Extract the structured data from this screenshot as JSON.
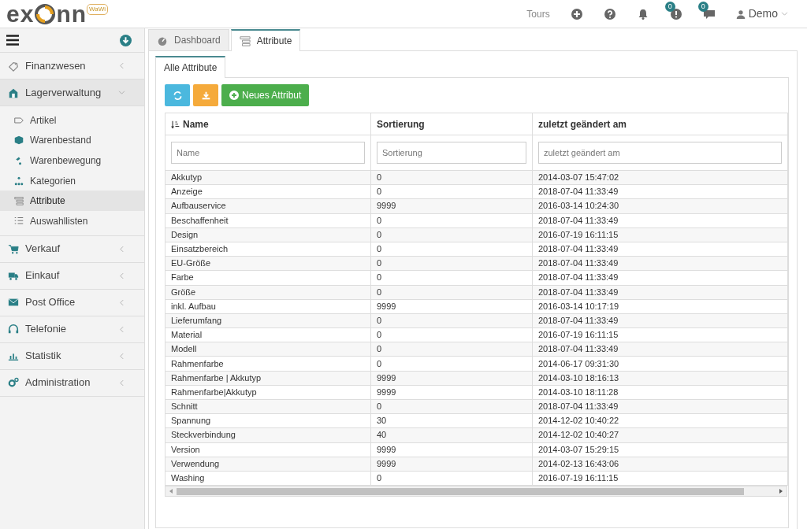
{
  "logo": {
    "left": "ex",
    "right": "nn",
    "badge": "WaWi"
  },
  "header": {
    "tours": "Tours",
    "alert_count": "0",
    "message_count": "0",
    "user": "Demo"
  },
  "sidebar": {
    "items": [
      {
        "label": "Finanzwesen",
        "expanded": false
      },
      {
        "label": "Lagerverwaltung",
        "expanded": true,
        "children": [
          {
            "label": "Artikel",
            "selected": false
          },
          {
            "label": "Warenbestand",
            "selected": false
          },
          {
            "label": "Warenbewegung",
            "selected": false
          },
          {
            "label": "Kategorien",
            "selected": false
          },
          {
            "label": "Attribute",
            "selected": true
          },
          {
            "label": "Auswahllisten",
            "selected": false
          }
        ]
      },
      {
        "label": "Verkauf",
        "expanded": false
      },
      {
        "label": "Einkauf",
        "expanded": false
      },
      {
        "label": "Post Office",
        "expanded": false
      },
      {
        "label": "Telefonie",
        "expanded": false
      },
      {
        "label": "Statistik",
        "expanded": false
      },
      {
        "label": "Administration",
        "expanded": false
      }
    ]
  },
  "tabs": [
    {
      "label": "Dashboard",
      "selected": false
    },
    {
      "label": "Attribute",
      "selected": true
    }
  ],
  "subtabs": [
    {
      "label": "Alle Attribute",
      "selected": true
    }
  ],
  "toolbar": {
    "new_button": "Neues Attribut"
  },
  "table": {
    "columns": [
      {
        "label": "Name",
        "placeholder": "Name",
        "sorted": true
      },
      {
        "label": "Sortierung",
        "placeholder": "Sortierung",
        "sorted": false
      },
      {
        "label": "zuletzt geändert am",
        "placeholder": "zuletzt geändert am",
        "sorted": false
      }
    ],
    "rows": [
      [
        "Akkutyp",
        "0",
        "2014-03-07 15:47:02"
      ],
      [
        "Anzeige",
        "0",
        "2018-07-04 11:33:49"
      ],
      [
        "Aufbauservice",
        "9999",
        "2016-03-14 10:24:30"
      ],
      [
        "Beschaffenheit",
        "0",
        "2018-07-04 11:33:49"
      ],
      [
        "Design",
        "0",
        "2016-07-19 16:11:15"
      ],
      [
        "Einsatzbereich",
        "0",
        "2018-07-04 11:33:49"
      ],
      [
        "EU-Größe",
        "0",
        "2018-07-04 11:33:49"
      ],
      [
        "Farbe",
        "0",
        "2018-07-04 11:33:49"
      ],
      [
        "Größe",
        "0",
        "2018-07-04 11:33:49"
      ],
      [
        "inkl. Aufbau",
        "9999",
        "2016-03-14 10:17:19"
      ],
      [
        "Lieferumfang",
        "0",
        "2018-07-04 11:33:49"
      ],
      [
        "Material",
        "0",
        "2016-07-19 16:11:15"
      ],
      [
        "Modell",
        "0",
        "2018-07-04 11:33:49"
      ],
      [
        "Rahmenfarbe",
        "0",
        "2014-06-17 09:31:30"
      ],
      [
        "Rahmenfarbe | Akkutyp",
        "9999",
        "2014-03-10 18:16:13"
      ],
      [
        "Rahmenfarbe|Akkutyp",
        "9999",
        "2014-03-10 18:11:28"
      ],
      [
        "Schnitt",
        "0",
        "2018-07-04 11:33:49"
      ],
      [
        "Spannung",
        "30",
        "2014-12-02 10:40:22"
      ],
      [
        "Steckverbindung",
        "40",
        "2014-12-02 10:40:27"
      ],
      [
        "Version",
        "9999",
        "2014-03-07 15:29:15"
      ],
      [
        "Verwendung",
        "9999",
        "2014-02-13 16:43:06"
      ],
      [
        "Washing",
        "0",
        "2016-07-19 16:11:15"
      ]
    ]
  }
}
